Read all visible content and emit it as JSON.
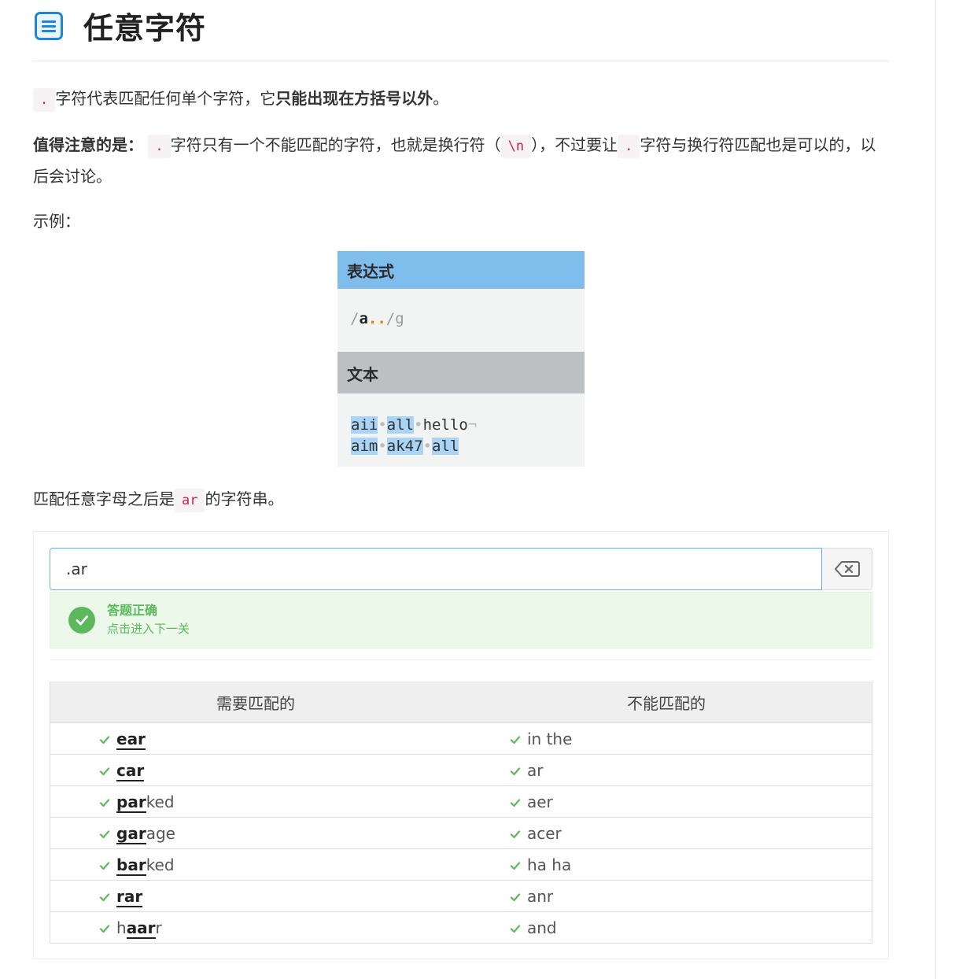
{
  "header": {
    "title": "任意字符",
    "icon": "document-list-icon"
  },
  "intro": {
    "dot_code": ".",
    "text1": "字符代表匹配任何单个字符，它",
    "bold1": "只能出现在方括号以外",
    "end1": "。"
  },
  "note": {
    "label": "值得注意的是：",
    "dot_code": ".",
    "text1": "字符只有一个不能匹配的字符，也就是换行符（",
    "newline_code": "\\n",
    "text2": "），不过要让",
    "dot_code2": ".",
    "text3": "字符与换行符匹配也是可以的，以后会讨论。"
  },
  "example_label": "示例：",
  "example_image": {
    "expr_header": "表达式",
    "expr_slash1": "/",
    "expr_a": "a",
    "expr_dots": "..",
    "expr_slash2": "/g",
    "text_header": "文本",
    "line1": {
      "m1": "aii",
      "m2": "all",
      "plain": "hello",
      "eol": "¬"
    },
    "line2": {
      "m1": "aim",
      "m2": "ak47",
      "m3": "all"
    },
    "space_mark": "•"
  },
  "task": {
    "text1": "匹配任意字母之后是",
    "code": "ar",
    "text2": "的字符串。"
  },
  "exercise": {
    "input_value": ".ar",
    "clear_icon": "backspace-icon",
    "success_title": "答题正确",
    "success_sub": "点击进入下一关",
    "col_match": "需要匹配的",
    "col_nomatch": "不能匹配的",
    "rows": [
      {
        "m_pre": "",
        "m_hit": "ear",
        "m_post": "",
        "n": "in the"
      },
      {
        "m_pre": "",
        "m_hit": "car",
        "m_post": "",
        "n": "ar"
      },
      {
        "m_pre": "",
        "m_hit": "par",
        "m_post": "ked",
        "n": "aer"
      },
      {
        "m_pre": "",
        "m_hit": "gar",
        "m_post": "age",
        "n": "acer"
      },
      {
        "m_pre": "",
        "m_hit": "bar",
        "m_post": "ked",
        "n": "ha ha"
      },
      {
        "m_pre": "",
        "m_hit": "rar",
        "m_post": "",
        "n": "anr"
      },
      {
        "m_pre": "h",
        "m_hit": "aar",
        "m_post": "r",
        "n": "and"
      }
    ]
  },
  "colors": {
    "accent": "#1d86d7",
    "success": "#5cb85c",
    "code": "#c7254e"
  }
}
